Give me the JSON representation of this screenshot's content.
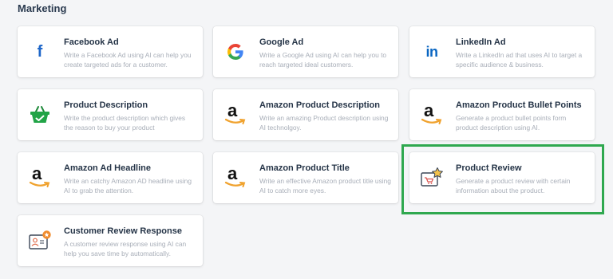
{
  "section": {
    "title": "Marketing"
  },
  "cards": [
    {
      "title": "Facebook Ad",
      "desc": "Write a Facebook Ad using AI can help you create targeted ads for a customer.",
      "icon": "facebook-icon"
    },
    {
      "title": "Google Ad",
      "desc": "Write a Google Ad using AI can help you to reach targeted ideal customers.",
      "icon": "google-icon"
    },
    {
      "title": "LinkedIn Ad",
      "desc": "Write a LinkedIn ad that uses AI to target a specific audience & business.",
      "icon": "linkedin-icon"
    },
    {
      "title": "Product Description",
      "desc": "Write the product description which gives the reason to buy your product",
      "icon": "shopping-basket-icon"
    },
    {
      "title": "Amazon Product Description",
      "desc": "Write an amazing Product description using AI technolgoy.",
      "icon": "amazon-icon"
    },
    {
      "title": "Amazon Product Bullet Points",
      "desc": "Generate a product bullet points form product description using AI.",
      "icon": "amazon-icon"
    },
    {
      "title": "Amazon Ad Headline",
      "desc": "Write an catchy Amazon AD headline using AI to grab the attention.",
      "icon": "amazon-icon"
    },
    {
      "title": "Amazon Product Title",
      "desc": "Write an effective Amazon product title using AI to catch more eyes.",
      "icon": "amazon-icon"
    },
    {
      "title": "Product Review",
      "desc": "Generate a product review with certain information about the product.",
      "icon": "product-review-icon"
    },
    {
      "title": "Customer Review Response",
      "desc": "A customer review response using AI can help you save time by automatically.",
      "icon": "customer-review-icon"
    }
  ],
  "colors": {
    "highlight": "#2fa84f",
    "facebook": "#1f67c9",
    "linkedin": "#0a66c2",
    "amazon_smile": "#f0a22e"
  }
}
